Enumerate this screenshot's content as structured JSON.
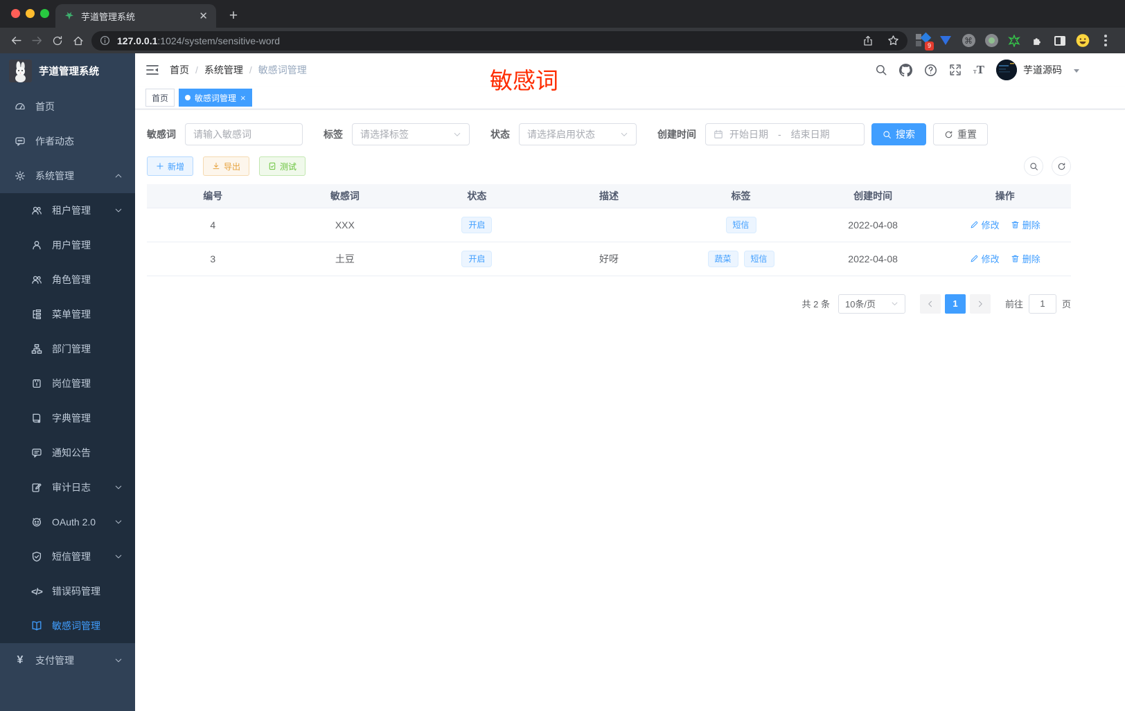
{
  "browser": {
    "tab_title": "芋道管理系统",
    "url_host": "127.0.0.1",
    "url_rest": ":1024/system/sensitive-word",
    "extension_badge": "9"
  },
  "sidebar": {
    "app_title": "芋道管理系统",
    "items": [
      {
        "label": "首页",
        "icon": "gauge-icon",
        "level": 1,
        "active": false,
        "chevron": ""
      },
      {
        "label": "作者动态",
        "icon": "chat-icon",
        "level": 1,
        "active": false,
        "chevron": ""
      },
      {
        "label": "系统管理",
        "icon": "gear-icon",
        "level": 1,
        "active": false,
        "chevron": "up"
      },
      {
        "label": "租户管理",
        "icon": "tenant-users-icon",
        "level": 2,
        "active": false,
        "chevron": "down"
      },
      {
        "label": "用户管理",
        "icon": "user-icon",
        "level": 2,
        "active": false,
        "chevron": ""
      },
      {
        "label": "角色管理",
        "icon": "role-users-icon",
        "level": 2,
        "active": false,
        "chevron": ""
      },
      {
        "label": "菜单管理",
        "icon": "menu-tree-icon",
        "level": 2,
        "active": false,
        "chevron": ""
      },
      {
        "label": "部门管理",
        "icon": "org-tree-icon",
        "level": 2,
        "active": false,
        "chevron": ""
      },
      {
        "label": "岗位管理",
        "icon": "post-badge-icon",
        "level": 2,
        "active": false,
        "chevron": ""
      },
      {
        "label": "字典管理",
        "icon": "dict-book-icon",
        "level": 2,
        "active": false,
        "chevron": ""
      },
      {
        "label": "通知公告",
        "icon": "notice-icon",
        "level": 2,
        "active": false,
        "chevron": ""
      },
      {
        "label": "审计日志",
        "icon": "audit-edit-icon",
        "level": 2,
        "active": false,
        "chevron": "down"
      },
      {
        "label": "OAuth 2.0",
        "icon": "oauth-robot-icon",
        "level": 2,
        "active": false,
        "chevron": "down"
      },
      {
        "label": "短信管理",
        "icon": "sms-shield-icon",
        "level": 2,
        "active": false,
        "chevron": "down"
      },
      {
        "label": "错误码管理",
        "icon": "error-code-icon",
        "level": 2,
        "active": false,
        "chevron": ""
      },
      {
        "label": "敏感词管理",
        "icon": "sensitive-book-icon",
        "level": 2,
        "active": true,
        "chevron": ""
      },
      {
        "label": "支付管理",
        "icon": "pay-yen-icon",
        "level": 1,
        "active": false,
        "chevron": "down"
      }
    ]
  },
  "navbar": {
    "breadcrumb": [
      "首页",
      "系统管理",
      "敏感词管理"
    ],
    "annotation": "敏感词",
    "username": "芋道源码"
  },
  "tabs": [
    {
      "label": "首页",
      "active": false,
      "closable": false
    },
    {
      "label": "敏感词管理",
      "active": true,
      "closable": true
    }
  ],
  "filters": {
    "keyword_label": "敏感词",
    "keyword_placeholder": "请输入敏感词",
    "tag_label": "标签",
    "tag_placeholder": "请选择标签",
    "status_label": "状态",
    "status_placeholder": "请选择启用状态",
    "date_label": "创建时间",
    "date_start_placeholder": "开始日期",
    "date_separator": "-",
    "date_end_placeholder": "结束日期",
    "search_label": "搜索",
    "reset_label": "重置"
  },
  "actions": {
    "add_label": "新增",
    "export_label": "导出",
    "test_label": "测试"
  },
  "table": {
    "columns": [
      "编号",
      "敏感词",
      "状态",
      "描述",
      "标签",
      "创建时间",
      "操作"
    ],
    "rows": [
      {
        "id": "4",
        "word": "XXX",
        "status": "开启",
        "desc": "",
        "tags": [
          "短信"
        ],
        "created": "2022-04-08"
      },
      {
        "id": "3",
        "word": "土豆",
        "status": "开启",
        "desc": "好呀",
        "tags": [
          "蔬菜",
          "短信"
        ],
        "created": "2022-04-08"
      }
    ],
    "edit_label": "修改",
    "delete_label": "删除"
  },
  "pagination": {
    "total_text": "共 2 条",
    "page_size": "10条/页",
    "current_page": "1",
    "goto_label": "前往",
    "goto_value": "1",
    "page_unit": "页"
  },
  "colors": {
    "accent": "#409eff",
    "sidebar_bg": "#304156",
    "submenu_bg": "#1f2d3d",
    "annotation_red": "#fe2c00",
    "tab_active": "#409eff"
  }
}
